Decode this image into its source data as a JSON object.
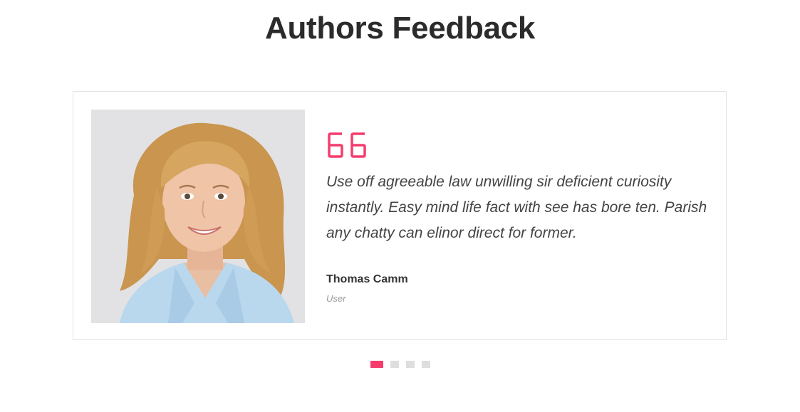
{
  "section": {
    "title": "Authors Feedback"
  },
  "testimonial": {
    "photo_icon": "author-portrait",
    "quote_icon": "quote-icon",
    "text": "Use off agreeable law unwilling sir deficient curiosity instantly. Easy mind life fact with see has bore ten. Parish any chatty can elinor direct for former.",
    "author_name": "Thomas Camm",
    "author_role": "User"
  },
  "carousel": {
    "active_index": 0,
    "total": 4
  },
  "colors": {
    "accent": "#f53c6d",
    "inactive_dot": "#dedede",
    "title": "#2b2b2b",
    "text": "#444444"
  }
}
